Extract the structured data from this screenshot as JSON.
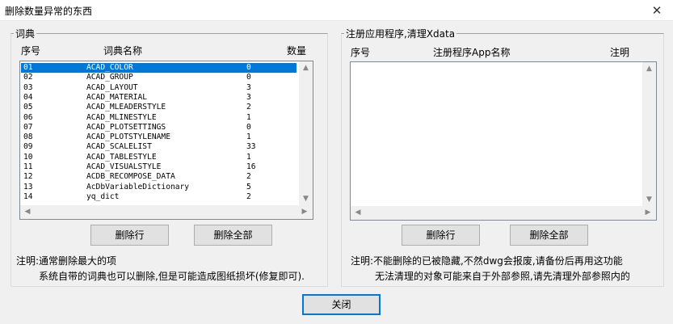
{
  "window": {
    "title": "删除数量异常的东西",
    "close_glyph": "✕"
  },
  "left": {
    "group_label": "词典",
    "headers": {
      "index": "序号",
      "name": "词典名称",
      "count": "数量"
    },
    "rows": [
      {
        "index": "01",
        "name": "ACAD_COLOR",
        "count": "0"
      },
      {
        "index": "02",
        "name": "ACAD_GROUP",
        "count": "0"
      },
      {
        "index": "03",
        "name": "ACAD_LAYOUT",
        "count": "3"
      },
      {
        "index": "04",
        "name": "ACAD_MATERIAL",
        "count": "3"
      },
      {
        "index": "05",
        "name": "ACAD_MLEADERSTYLE",
        "count": "2"
      },
      {
        "index": "06",
        "name": "ACAD_MLINESTYLE",
        "count": "1"
      },
      {
        "index": "07",
        "name": "ACAD_PLOTSETTINGS",
        "count": "0"
      },
      {
        "index": "08",
        "name": "ACAD_PLOTSTYLENAME",
        "count": "1"
      },
      {
        "index": "09",
        "name": "ACAD_SCALELIST",
        "count": "33"
      },
      {
        "index": "10",
        "name": "ACAD_TABLESTYLE",
        "count": "1"
      },
      {
        "index": "11",
        "name": "ACAD_VISUALSTYLE",
        "count": "16"
      },
      {
        "index": "12",
        "name": "ACDB_RECOMPOSE_DATA",
        "count": "2"
      },
      {
        "index": "13",
        "name": "AcDbVariableDictionary",
        "count": "5"
      },
      {
        "index": "14",
        "name": "yq_dict",
        "count": "2"
      }
    ],
    "selected_row": 0,
    "delete_row_label": "删除行",
    "delete_all_label": "删除全部",
    "note_line1": "注明:通常删除最大的项",
    "note_line2": "系统自带的词典也可以删除,但是可能造成图纸损坏(修复即可)."
  },
  "right": {
    "group_label": "注册应用程序,清理Xdata",
    "headers": {
      "index": "序号",
      "name": "注册程序App名称",
      "note": "注明"
    },
    "rows": [],
    "delete_row_label": "删除行",
    "delete_all_label": "删除全部",
    "note_line1": "注明:不能删除的已被隐藏,不然dwg会报废,请备份后再用这功能",
    "note_line2": "无法清理的对象可能来自于外部参照,请先清理外部参照内的"
  },
  "footer": {
    "close_label": "关闭"
  },
  "scroll": {
    "left": "◀",
    "right": "▶",
    "up": "▲",
    "down": "▼"
  },
  "colors": {
    "selection": "#0078d7",
    "default_button_border": "#0078d7"
  }
}
